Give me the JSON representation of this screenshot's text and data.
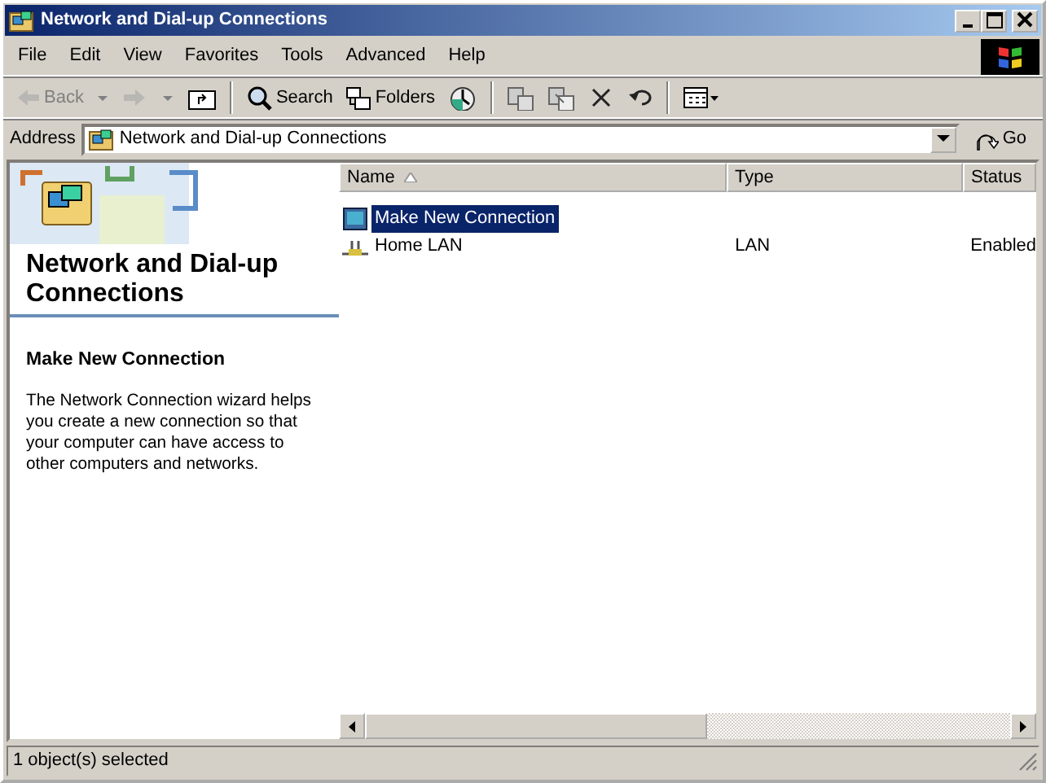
{
  "window": {
    "title": "Network and Dial-up Connections"
  },
  "menu": [
    "File",
    "Edit",
    "View",
    "Favorites",
    "Tools",
    "Advanced",
    "Help"
  ],
  "toolbar": [
    {
      "kind": "back",
      "label": "Back",
      "disabled": true
    },
    {
      "kind": "forward",
      "disabled": true
    },
    {
      "kind": "up",
      "disabled": false
    },
    {
      "kind": "separator"
    },
    {
      "kind": "search",
      "label": "Search",
      "disabled": false
    },
    {
      "kind": "folders",
      "label": "Folders",
      "disabled": false
    },
    {
      "kind": "history",
      "disabled": false
    },
    {
      "kind": "separator"
    },
    {
      "kind": "move",
      "disabled": false
    },
    {
      "kind": "copy",
      "disabled": false
    },
    {
      "kind": "delete",
      "disabled": false
    },
    {
      "kind": "undo",
      "disabled": false
    },
    {
      "kind": "separator"
    },
    {
      "kind": "views",
      "disabled": false
    }
  ],
  "address": {
    "label": "Address",
    "value": "Network and Dial-up Connections",
    "go": "Go"
  },
  "sidebar": {
    "title": "Network and Dial-up Connections",
    "heading": "Make New Connection",
    "description": "The Network Connection wizard helps you create a new connection so that your computer can have access to other computers and networks."
  },
  "table": {
    "columns": [
      {
        "label": "Name",
        "sorted": true
      },
      {
        "label": "Type",
        "sorted": false
      },
      {
        "label": "Status",
        "sorted": false
      }
    ],
    "rows": [
      {
        "kind": "wizard",
        "name": "Make New Connection",
        "type": "",
        "status": "",
        "selected": true
      },
      {
        "kind": "lan",
        "name": "Home LAN",
        "type": "LAN",
        "status": "Enabled",
        "selected": false
      }
    ]
  },
  "status_bar": "1 object(s) selected"
}
